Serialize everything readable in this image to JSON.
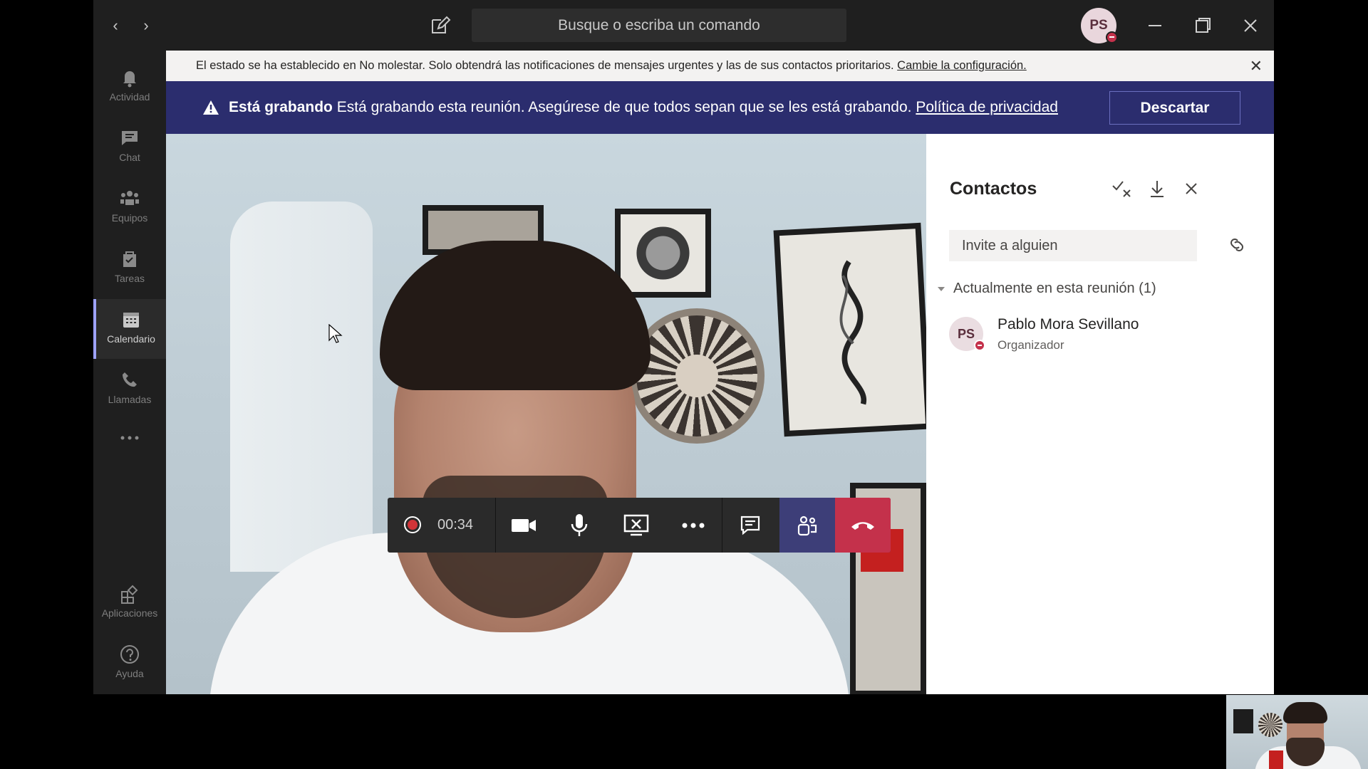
{
  "titlebar": {
    "search_placeholder": "Busque o escriba un comando",
    "avatar_initials": "PS"
  },
  "rail": {
    "items": [
      {
        "label": "Actividad",
        "icon": "bell-icon"
      },
      {
        "label": "Chat",
        "icon": "chat-icon"
      },
      {
        "label": "Equipos",
        "icon": "teams-icon"
      },
      {
        "label": "Tareas",
        "icon": "tasks-icon"
      },
      {
        "label": "Calendario",
        "icon": "calendar-icon"
      },
      {
        "label": "Llamadas",
        "icon": "phone-icon"
      },
      {
        "label": "Aplicaciones",
        "icon": "apps-icon"
      },
      {
        "label": "Ayuda",
        "icon": "help-icon"
      }
    ],
    "active": "Calendario"
  },
  "dnd_banner": {
    "text": "El estado se ha establecido en No molestar. Solo obtendrá las notificaciones de mensajes urgentes y las de sus contactos prioritarios.",
    "link": "Cambie la configuración."
  },
  "rec_banner": {
    "title": "Está grabando",
    "text": "Está grabando esta reunión. Asegúrese de que todos sepan que se les está grabando.",
    "link": "Política de privacidad",
    "dismiss_label": "Descartar"
  },
  "controls": {
    "timer": "00:34"
  },
  "panel": {
    "title": "Contactos",
    "invite_placeholder": "Invite a alguien",
    "section_label": "Actualmente en esta reunión (1)",
    "members": [
      {
        "initials": "PS",
        "name": "Pablo Mora Sevillano",
        "role": "Organizador"
      }
    ]
  },
  "colors": {
    "brand": "#2b2d6e",
    "hangup": "#c4314b",
    "dnd": "#c4314b",
    "people_active": "#3d3e78"
  }
}
